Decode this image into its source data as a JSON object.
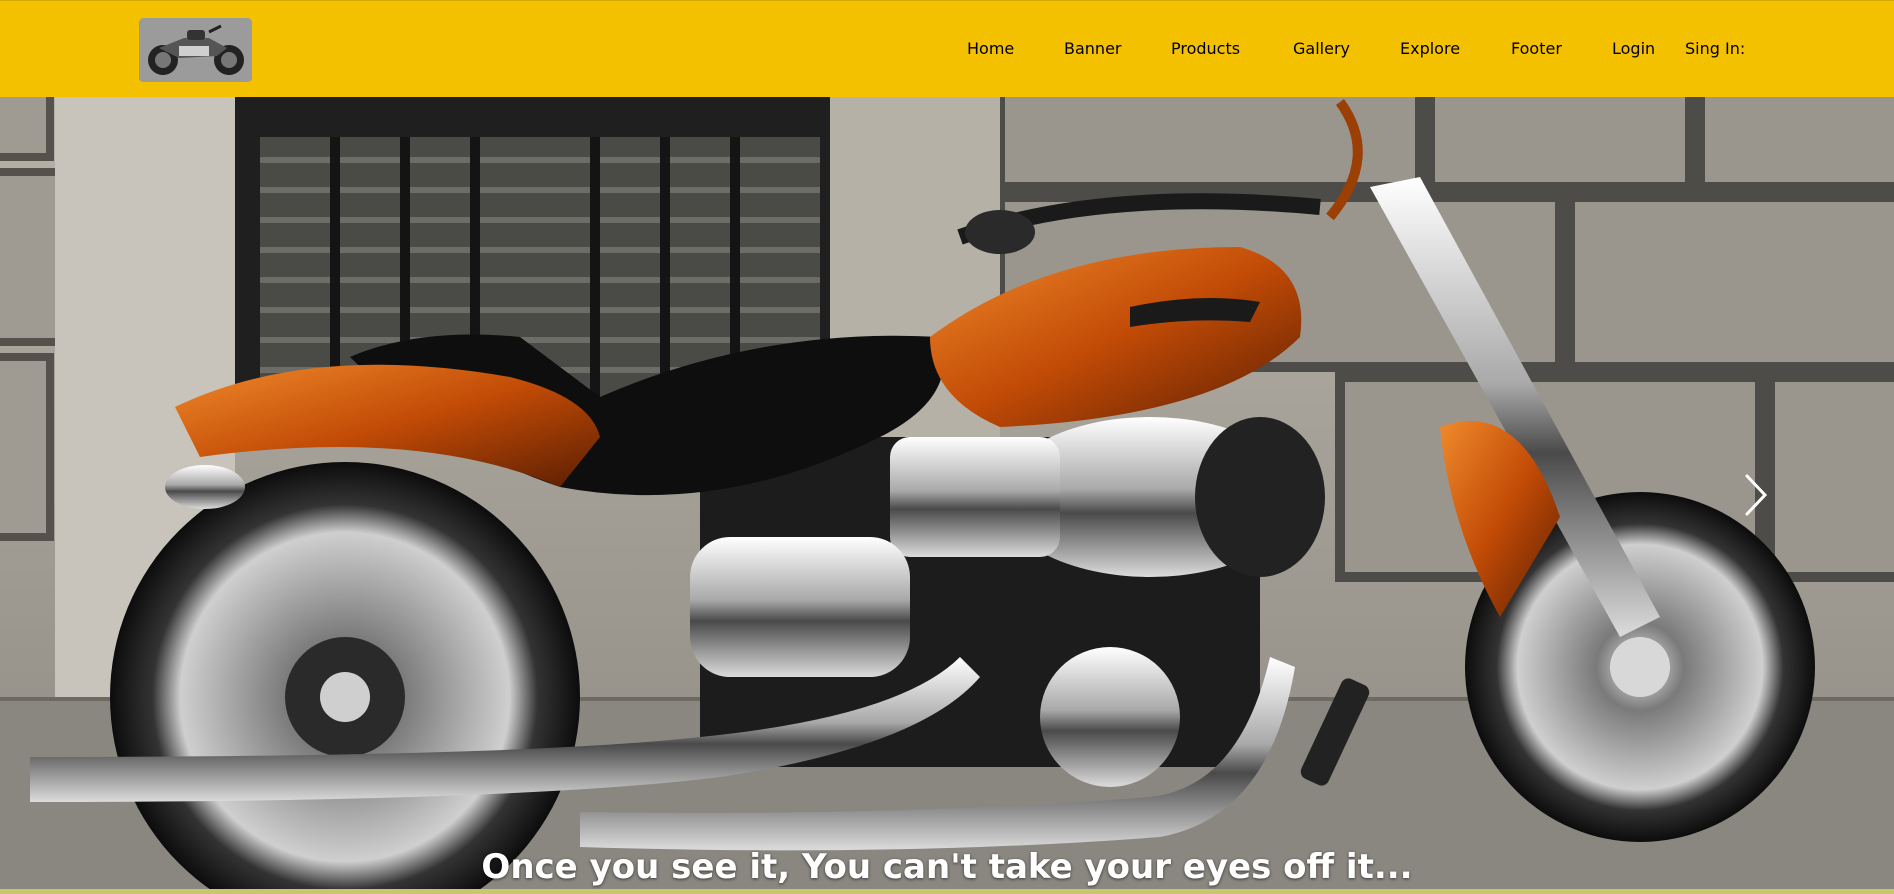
{
  "nav": {
    "logo_icon": "motorcycle-logo-icon",
    "items": [
      {
        "label": "Home"
      },
      {
        "label": "Banner"
      },
      {
        "label": "Products"
      },
      {
        "label": "Gallery"
      },
      {
        "label": "Explore"
      },
      {
        "label": "Footer"
      },
      {
        "label": "Login"
      },
      {
        "label": "Sing In:"
      }
    ]
  },
  "hero": {
    "caption": "Once you see it, You can't take your eyes off it...",
    "next_icon": "chevron-right-icon"
  },
  "colors": {
    "navbar": "#f4c100",
    "nav_text": "#ffffff",
    "accent_orange": "#d0560a"
  }
}
